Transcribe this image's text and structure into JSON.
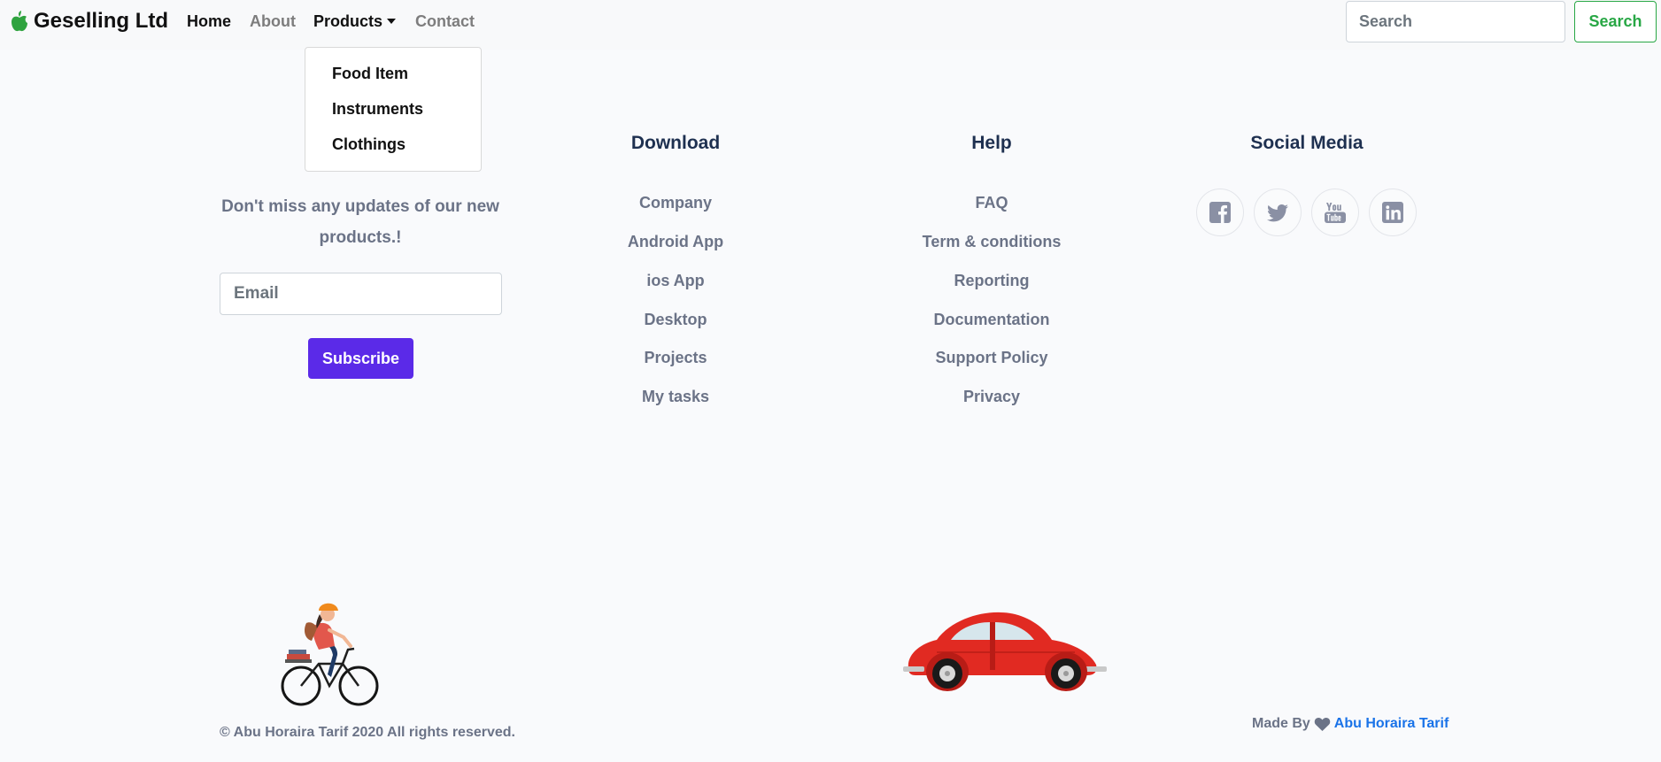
{
  "navbar": {
    "brand": "Geselling Ltd",
    "brand_icon": "apple-icon",
    "links": [
      {
        "label": "Home",
        "state": "active"
      },
      {
        "label": "About",
        "state": "normal"
      },
      {
        "label": "Products",
        "state": "open"
      },
      {
        "label": "Contact",
        "state": "normal"
      }
    ],
    "search_placeholder": "Search",
    "search_button": "Search",
    "accent_color": "#28a745"
  },
  "products_dropdown": {
    "items": [
      "Food Item",
      "Instruments",
      "Clothings"
    ]
  },
  "newsletter": {
    "text": "Don't miss any updates of our new products.!",
    "email_placeholder": "Email",
    "button": "Subscribe",
    "button_color": "#5b2ae8"
  },
  "download": {
    "title": "Download",
    "links": [
      "Company",
      "Android App",
      "ios App",
      "Desktop",
      "Projects",
      "My tasks"
    ]
  },
  "help": {
    "title": "Help",
    "links": [
      "FAQ",
      "Term & conditions",
      "Reporting",
      "Documentation",
      "Support Policy",
      "Privacy"
    ]
  },
  "social_media": {
    "title": "Social Media",
    "icons": [
      "facebook-icon",
      "twitter-icon",
      "youtube-icon",
      "linkedin-icon"
    ]
  },
  "footer": {
    "copyright": "© Abu Horaira Tarif 2020 All rights reserved.",
    "made_by": "Made By",
    "author": "Abu Horaira Tarif",
    "author_color": "#1a73e8"
  }
}
